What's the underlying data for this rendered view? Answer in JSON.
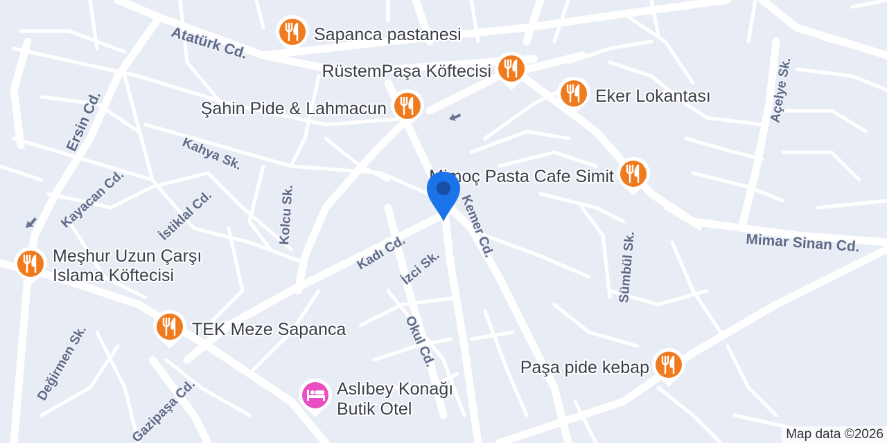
{
  "streets": {
    "ataturk": "Atatürk Cd.",
    "ersin": "Ersin Cd.",
    "kayacan": "Kayacan Cd.",
    "kahya": "Kahya Sk.",
    "istiklal": "İstiklal Cd.",
    "kolcu": "Kolcu Sk.",
    "kadi": "Kadı Cd.",
    "izci": "İzci Sk.",
    "kemer": "Kemer Cd.",
    "okul": "Okul Cd.",
    "degirmen": "Değirmen Sk.",
    "gazipasa": "Gazipaşa Cd.",
    "sumbul": "Sümbül Sk.",
    "acelye": "Açelye Sk.",
    "mimar_sinan": "Mimar Sinan Cd."
  },
  "pois": {
    "sapanca_pastanesi": "Sapanca pastanesi",
    "rustempasa": "RüstemPaşa Köftecisi",
    "eker": "Eker Lokantası",
    "sahin": "Şahin Pide & Lahmacun",
    "pasta_cafe": "Mimoç Pasta Cafe Simit",
    "meshur_1": "Meşhur Uzun Çarşı",
    "meshur_2": "Islama Köftecisi",
    "tek_meze": "TEK Meze Sapanca",
    "pasa_pide": "Paşa pide kebap",
    "aslibey_1": "Aslıbey Konağı",
    "aslibey_2": "Butik Otel"
  },
  "colors": {
    "background": "#e8ecf5",
    "road": "#ffffff",
    "street_label": "#5e6a86",
    "restaurant_pin": "#f07b1f",
    "hotel_pin": "#e94ec2",
    "location_pin": "#1a73e8"
  },
  "icons": {
    "restaurant": "fork-knife-icon",
    "hotel": "bed-icon",
    "location": "location-pin-icon",
    "direction": "direction-arrow-icon"
  },
  "attribution": "Map data ©2026"
}
